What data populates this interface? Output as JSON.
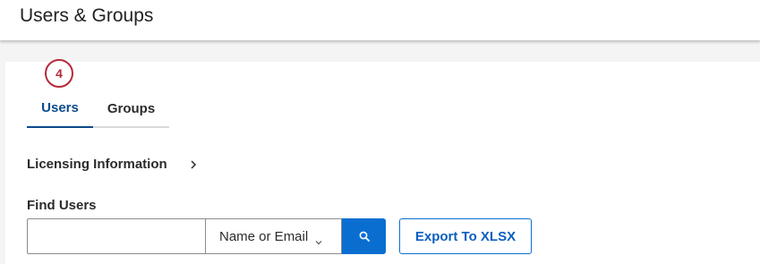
{
  "header": {
    "title": "Users & Groups"
  },
  "step_badge": {
    "number": "4",
    "color": "#b52a3b"
  },
  "tabs": [
    {
      "label": "Users",
      "active": true
    },
    {
      "label": "Groups",
      "active": false
    }
  ],
  "licensing": {
    "label": "Licensing Information",
    "icon": "chevron-right-icon"
  },
  "find_users": {
    "label": "Find Users",
    "input_value": "",
    "input_placeholder": "",
    "search_by": {
      "selected": "Name or Email",
      "icon": "chevron-down-icon"
    },
    "search_button_icon": "search-icon",
    "export_label": "Export To XLSX"
  },
  "colors": {
    "accent": "#0a6ed1",
    "active_tab": "#0a4a8a",
    "badge": "#b52a3b"
  }
}
